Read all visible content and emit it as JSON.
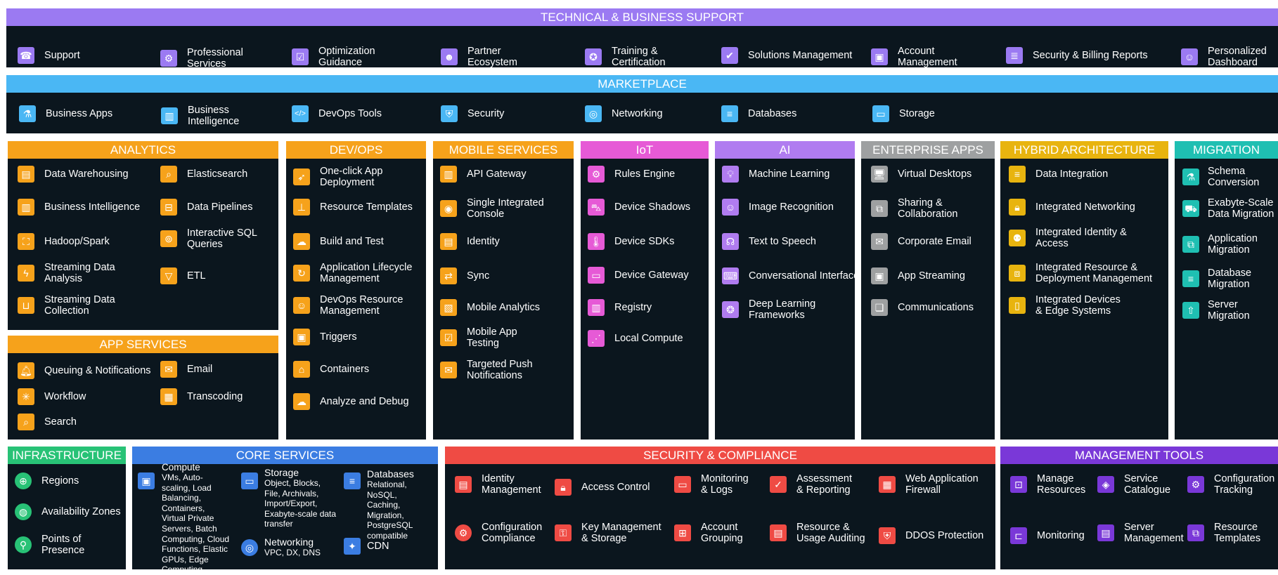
{
  "colors": {
    "support": "#9b7af2",
    "marketplace": "#4ab7f4",
    "orange": "#f6a21b",
    "iot": "#e65ad6",
    "ai": "#b07cf0",
    "enterprise": "#9ea0a1",
    "hybrid": "#e8b40f",
    "migration": "#1fbfb2",
    "infrastructure": "#28c276",
    "core": "#3b7de2",
    "security": "#ef4b44",
    "management": "#7a38d8",
    "panel": "#0b161e"
  },
  "support": {
    "title": "TECHNICAL & BUSINESS SUPPORT",
    "items": [
      {
        "label": "Support",
        "icon": "headset-icon"
      },
      {
        "label": "Professional\nServices",
        "icon": "person-gear-icon"
      },
      {
        "label": "Optimization\nGuidance",
        "icon": "checklist-icon"
      },
      {
        "label": "Partner\nEcosystem",
        "icon": "people-icon"
      },
      {
        "label": "Training &\nCertification",
        "icon": "award-icon"
      },
      {
        "label": "Solutions Management",
        "icon": "person-check-icon"
      },
      {
        "label": "Account\nManagement",
        "icon": "briefcase-icon"
      },
      {
        "label": "Security & Billing Reports",
        "icon": "report-icon"
      },
      {
        "label": "Personalized\nDashboard",
        "icon": "person-dashboard-icon"
      }
    ]
  },
  "marketplace": {
    "title": "MARKETPLACE",
    "items": [
      {
        "label": "Business Apps",
        "icon": "test-tube-icon"
      },
      {
        "label": "Business\nIntelligence",
        "icon": "bar-chart-icon"
      },
      {
        "label": "DevOps Tools",
        "icon": "code-icon"
      },
      {
        "label": "Security",
        "icon": "shield-icon"
      },
      {
        "label": "Networking",
        "icon": "network-icon"
      },
      {
        "label": "Databases",
        "icon": "database-icon"
      },
      {
        "label": "Storage",
        "icon": "storage-box-icon"
      }
    ]
  },
  "analytics": {
    "title": "ANALYTICS",
    "items": [
      {
        "label": "Data Warehousing",
        "icon": "warehouse-icon"
      },
      {
        "label": "Elasticsearch",
        "icon": "search-icon"
      },
      {
        "label": "Business Intelligence",
        "icon": "bar-chart-icon"
      },
      {
        "label": "Data Pipelines",
        "icon": "pipeline-icon"
      },
      {
        "label": "Hadoop/Spark",
        "icon": "cluster-icon"
      },
      {
        "label": "Interactive SQL\nQueries",
        "icon": "query-icon"
      },
      {
        "label": "Streaming Data\nAnalysis",
        "icon": "lightning-icon"
      },
      {
        "label": "ETL",
        "icon": "funnel-icon"
      },
      {
        "label": "Streaming Data\nCollection",
        "icon": "bucket-icon"
      }
    ]
  },
  "appservices": {
    "title": "APP SERVICES",
    "items": [
      {
        "label": "Queuing & Notifications",
        "icon": "bell-icon"
      },
      {
        "label": "Email",
        "icon": "email-icon"
      },
      {
        "label": "Workflow",
        "icon": "workflow-icon"
      },
      {
        "label": "Transcoding",
        "icon": "film-icon"
      },
      {
        "label": "Search",
        "icon": "search-icon"
      }
    ]
  },
  "devops": {
    "title": "DEV/OPS",
    "items": [
      {
        "label": "One-click App\nDeployment",
        "icon": "rocket-icon"
      },
      {
        "label": "Resource Templates",
        "icon": "stamp-icon"
      },
      {
        "label": "Build and Test",
        "icon": "cloud-code-icon"
      },
      {
        "label": "Application Lifecycle\nManagement",
        "icon": "cycle-icon"
      },
      {
        "label": "DevOps Resource\nManagement",
        "icon": "person-icon"
      },
      {
        "label": "Triggers",
        "icon": "chip-icon"
      },
      {
        "label": "Containers",
        "icon": "container-icon"
      },
      {
        "label": "Analyze and Debug",
        "icon": "cloud-icon"
      }
    ]
  },
  "mobile": {
    "title": "MOBILE SERVICES",
    "items": [
      {
        "label": "API Gateway",
        "icon": "gateway-icon"
      },
      {
        "label": "Single Integrated\nConsole",
        "icon": "console-icon"
      },
      {
        "label": "Identity",
        "icon": "id-card-icon"
      },
      {
        "label": "Sync",
        "icon": "sync-icon"
      },
      {
        "label": "Mobile Analytics",
        "icon": "analytics-icon"
      },
      {
        "label": "Mobile App\nTesting",
        "icon": "checkbox-icon"
      },
      {
        "label": "Targeted Push\nNotifications",
        "icon": "message-icon"
      }
    ]
  },
  "iot": {
    "title": "IoT",
    "items": [
      {
        "label": "Rules Engine",
        "icon": "gears-icon"
      },
      {
        "label": "Device Shadows",
        "icon": "car-icon"
      },
      {
        "label": "Device SDKs",
        "icon": "thermometer-icon"
      },
      {
        "label": "Device Gateway",
        "icon": "monitor-icon"
      },
      {
        "label": "Registry",
        "icon": "book-icon"
      },
      {
        "label": "Local Compute",
        "icon": "nodes-icon"
      }
    ]
  },
  "ai": {
    "title": "AI",
    "items": [
      {
        "label": "Machine Learning",
        "icon": "bulb-icon"
      },
      {
        "label": "Image Recognition",
        "icon": "person-frame-icon"
      },
      {
        "label": "Text to Speech",
        "icon": "speaking-icon"
      },
      {
        "label": "Conversational Interface",
        "icon": "chat-icon"
      },
      {
        "label": "Deep Learning\nFrameworks",
        "icon": "brain-icon"
      }
    ]
  },
  "enterprise": {
    "title": "ENTERPRISE APPS",
    "items": [
      {
        "label": "Virtual Desktops",
        "icon": "desktop-icon"
      },
      {
        "label": "Sharing &\nCollaboration",
        "icon": "share-icon"
      },
      {
        "label": "Corporate Email",
        "icon": "envelope-icon"
      },
      {
        "label": "App Streaming",
        "icon": "stream-icon"
      },
      {
        "label": "Communications",
        "icon": "comments-icon"
      }
    ]
  },
  "hybrid": {
    "title": "HYBRID ARCHITECTURE",
    "items": [
      {
        "label": "Data Integration",
        "icon": "database-icon"
      },
      {
        "label": "Integrated Networking",
        "icon": "lock-icon"
      },
      {
        "label": "Integrated Identity &\nAccess",
        "icon": "identity-icon"
      },
      {
        "label": "Integrated Resource &\nDeployment Management",
        "icon": "boxes-icon"
      },
      {
        "label": "Integrated Devices\n& Edge Systems",
        "icon": "devices-icon"
      }
    ]
  },
  "migration": {
    "title": "MIGRATION",
    "items": [
      {
        "label": "Schema\nConversion",
        "icon": "flask-icon"
      },
      {
        "label": "Exabyte-Scale\nData Migration",
        "icon": "truck-icon"
      },
      {
        "label": "Application\nMigration",
        "icon": "app-migrate-icon"
      },
      {
        "label": "Database\nMigration",
        "icon": "database-icon"
      },
      {
        "label": "Server\nMigration",
        "icon": "server-icon"
      }
    ]
  },
  "infrastructure": {
    "title": "INFRASTRUCTURE",
    "items": [
      {
        "label": "Regions",
        "icon": "globe-icon"
      },
      {
        "label": "Availability Zones",
        "icon": "zone-icon"
      },
      {
        "label": "Points of\nPresence",
        "icon": "pin-icon"
      }
    ]
  },
  "core": {
    "title": "CORE SERVICES",
    "compute": {
      "name": "Compute",
      "desc": "VMs, Auto-\nscaling, Load\nBalancing,\nContainers,\nVirtual Private\nServers, Batch\nComputing, Cloud\nFunctions, Elastic\nGPUs, Edge\nComputing",
      "icon": "cpu-icon"
    },
    "storage": {
      "name": "Storage",
      "desc": "Object, Blocks,\nFile, Archivals,\nImport/Export,\nExabyte-scale data\ntransfer",
      "icon": "storage-icon"
    },
    "databases": {
      "name": "Databases",
      "desc": "Relational,\nNoSQL,\nCaching,\nMigration,\nPostgreSQL\ncompatible",
      "icon": "database-icon"
    },
    "networking": {
      "name": "Networking",
      "desc": "VPC, DX, DNS",
      "icon": "network-icon"
    },
    "cdn": {
      "name": "CDN",
      "icon": "cdn-icon"
    }
  },
  "security": {
    "title": "SECURITY & COMPLIANCE",
    "items": [
      {
        "label": "Identity\nManagement",
        "icon": "id-icon"
      },
      {
        "label": "Access Control",
        "icon": "padlock-icon"
      },
      {
        "label": "Monitoring\n& Logs",
        "icon": "monitor-log-icon"
      },
      {
        "label": "Assessment\n& Reporting",
        "icon": "assessment-icon"
      },
      {
        "label": "Web Application\nFirewall",
        "icon": "firewall-icon"
      },
      {
        "label": "Configuration\nCompliance",
        "icon": "compliance-icon"
      },
      {
        "label": "Key Management\n& Storage",
        "icon": "key-icon"
      },
      {
        "label": "Account\nGrouping",
        "icon": "org-chart-icon"
      },
      {
        "label": "Resource &\nUsage Auditing",
        "icon": "audit-icon"
      },
      {
        "label": "DDOS Protection",
        "icon": "ddos-icon"
      }
    ]
  },
  "management": {
    "title": "MANAGEMENT TOOLS",
    "items": [
      {
        "label": "Manage\nResources",
        "icon": "manage-icon"
      },
      {
        "label": "Service\nCatalogue",
        "icon": "catalogue-icon"
      },
      {
        "label": "Configuration\nTracking",
        "icon": "config-gear-icon"
      },
      {
        "label": "Monitoring",
        "icon": "monitoring-icon"
      },
      {
        "label": "Server\nManagement",
        "icon": "server-mgmt-icon"
      },
      {
        "label": "Resource\nTemplates",
        "icon": "template-icon"
      }
    ]
  }
}
